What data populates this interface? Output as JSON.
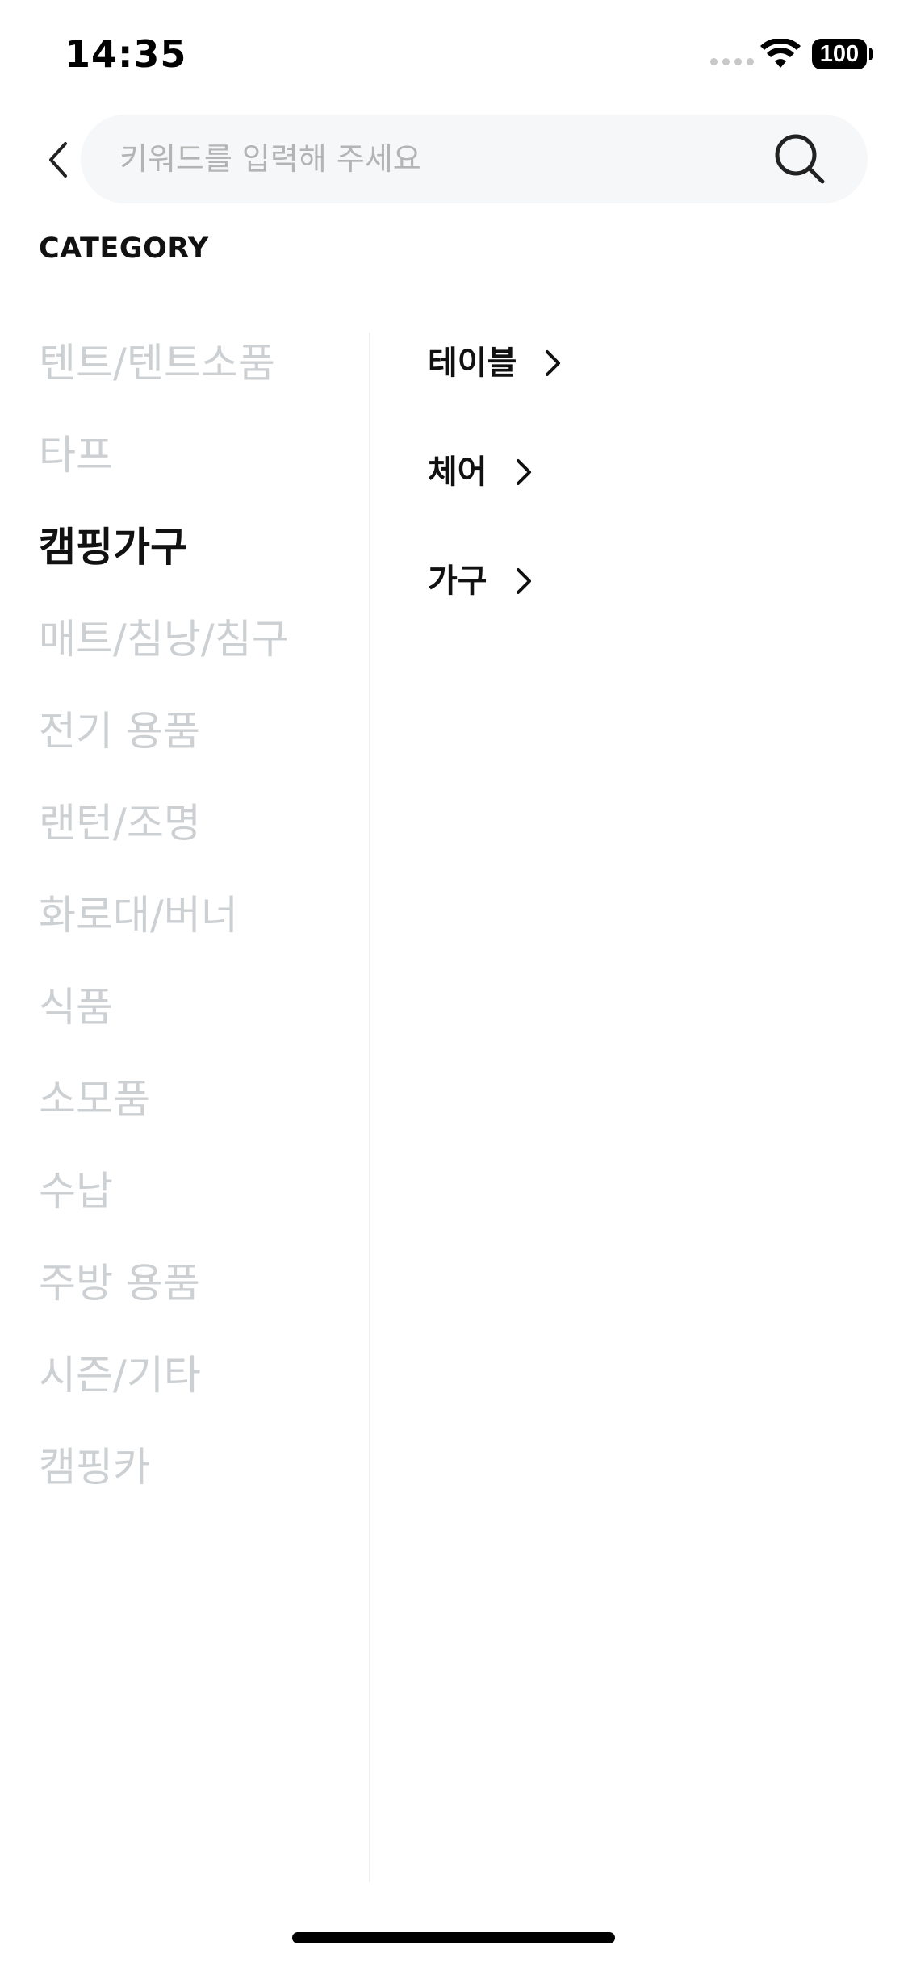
{
  "status_bar": {
    "time": "14:35",
    "battery": "100"
  },
  "search": {
    "placeholder": "키워드를 입력해 주세요",
    "value": ""
  },
  "section_title": "CATEGORY",
  "categories": [
    {
      "label": "텐트/텐트소품",
      "active": false
    },
    {
      "label": "타프",
      "active": false
    },
    {
      "label": "캠핑가구",
      "active": true
    },
    {
      "label": "매트/침낭/침구",
      "active": false
    },
    {
      "label": "전기 용품",
      "active": false
    },
    {
      "label": "랜턴/조명",
      "active": false
    },
    {
      "label": "화로대/버너",
      "active": false
    },
    {
      "label": "식품",
      "active": false
    },
    {
      "label": "소모품",
      "active": false
    },
    {
      "label": "수납",
      "active": false
    },
    {
      "label": "주방 용품",
      "active": false
    },
    {
      "label": "시즌/기타",
      "active": false
    },
    {
      "label": "캠핑카",
      "active": false
    }
  ],
  "subcategories": [
    {
      "label": "테이블"
    },
    {
      "label": "체어"
    },
    {
      "label": "가구"
    }
  ],
  "colors": {
    "active_text": "#111111",
    "inactive_text": "#cdd0d3",
    "search_bg": "#f6f7f9",
    "divider": "#efefef"
  }
}
